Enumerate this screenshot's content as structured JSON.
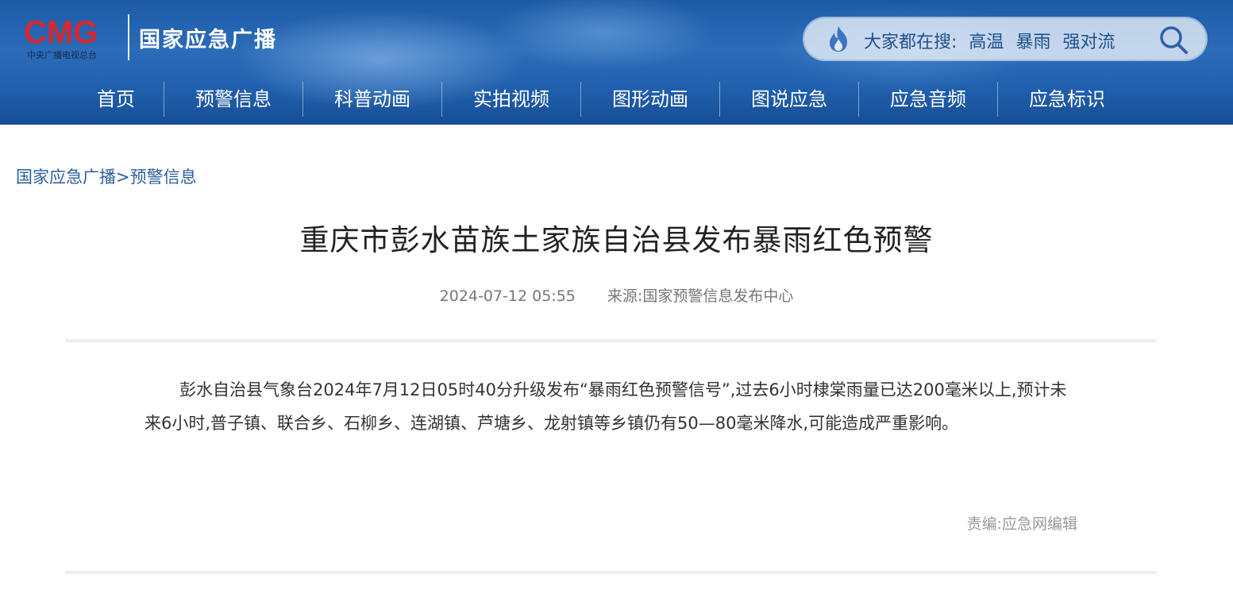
{
  "header": {
    "logo_text": "CMG",
    "logo_subtext": "中央广播电视总台",
    "site_name": "国家应急广播",
    "search": {
      "hot_label": "大家都在搜:",
      "hot_keywords": [
        "高温",
        "暴雨",
        "强对流"
      ]
    },
    "nav": [
      {
        "label": "首页"
      },
      {
        "label": "预警信息"
      },
      {
        "label": "科普动画"
      },
      {
        "label": "实拍视频"
      },
      {
        "label": "图形动画"
      },
      {
        "label": "图说应急"
      },
      {
        "label": "应急音频"
      },
      {
        "label": "应急标识"
      }
    ]
  },
  "breadcrumb": {
    "root": "国家应急广播",
    "separator": ">",
    "current": "预警信息"
  },
  "article": {
    "title": "重庆市彭水苗族土家族自治县发布暴雨红色预警",
    "date": "2024-07-12 05:55",
    "source": "来源:国家预警信息发布中心",
    "body": "彭水自治县气象台2024年7月12日05时40分升级发布“暴雨红色预警信号”,过去6小时棣棠雨量已达200毫米以上,预计未来6小时,普子镇、联合乡、石柳乡、连湖镇、芦塘乡、龙射镇等乡镇仍有50—80毫米降水,可能造成严重影响。",
    "editor": "责编:应急网编辑"
  },
  "colors": {
    "header_blue": "#2160ad",
    "logo_red": "#d7282f",
    "link_blue": "#2d5f9e"
  }
}
